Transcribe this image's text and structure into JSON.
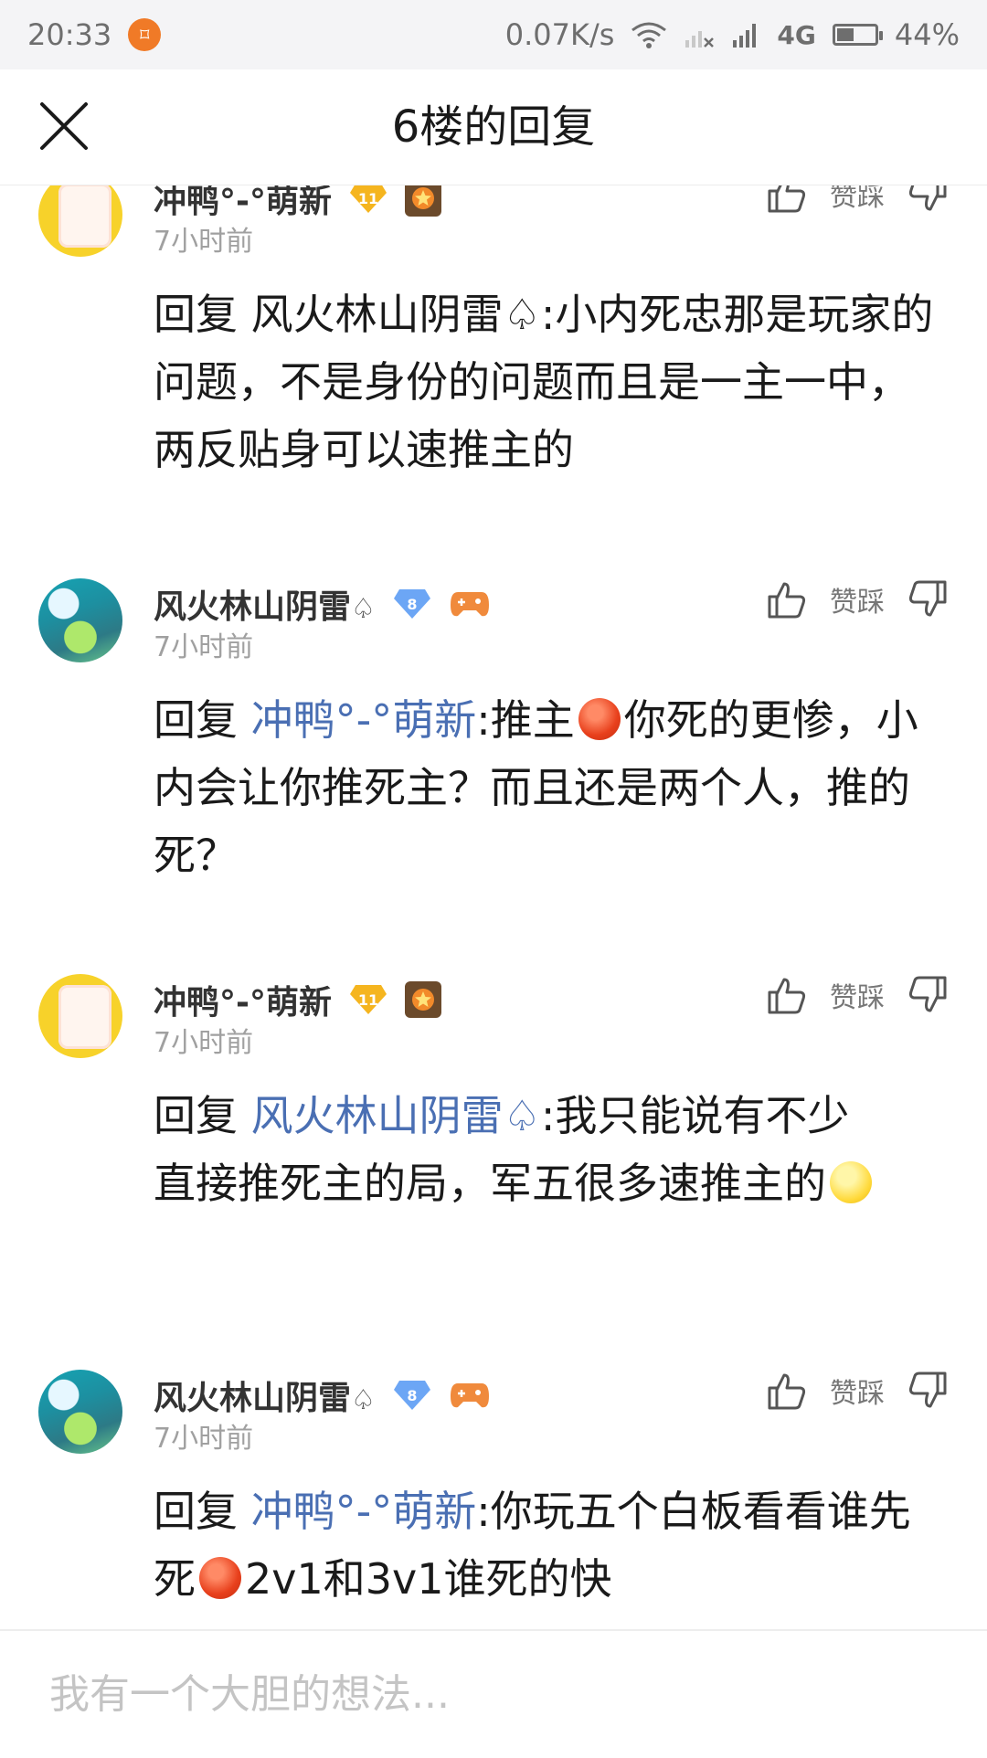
{
  "status_bar": {
    "time": "20:33",
    "net_speed": "0.07K/s",
    "network": "4G",
    "battery": "44%",
    "battery_level": 0.44
  },
  "nav": {
    "title": "6楼的回复"
  },
  "actions": {
    "label": "赞踩"
  },
  "posts": [
    {
      "author": "冲鸭°-°萌新",
      "level": "11",
      "time": "7小时前",
      "reply_prefix": "回复 ",
      "reply_to": "风火林山阴雷♤",
      "text": ":小内死忠那是玩家的问题，不是身份的问题而且是一主一中，两反贴身可以速推主的"
    },
    {
      "author": "风火林山阴雷",
      "author_suffix": "♤",
      "level": "8",
      "time": "7小时前",
      "reply_prefix": "回复 ",
      "reply_to": "冲鸭°-°萌新",
      "text_a": ":推主",
      "text_b": "你死的更惨，小内会让你推死主？而且还是两个人，推的死？"
    },
    {
      "author": "冲鸭°-°萌新",
      "level": "11",
      "time": "7小时前",
      "reply_prefix": "回复 ",
      "reply_to": "风火林山阴雷♤",
      "text": ":我只能说有不少直接推死主的局，军五很多速推主的"
    },
    {
      "author": "风火林山阴雷",
      "author_suffix": "♤",
      "level": "8",
      "time": "7小时前",
      "reply_prefix": "回复 ",
      "reply_to": "冲鸭°-°萌新",
      "text_a": ":你玩五个白板看看谁先死",
      "text_b": "2v1和3v1谁死的快"
    }
  ],
  "footer": {
    "placeholder": "我有一个大胆的想法..."
  },
  "colors": {
    "mention": "#4a6fb3",
    "time": "#a0a0a0",
    "placeholder": "#c4c4c4"
  }
}
